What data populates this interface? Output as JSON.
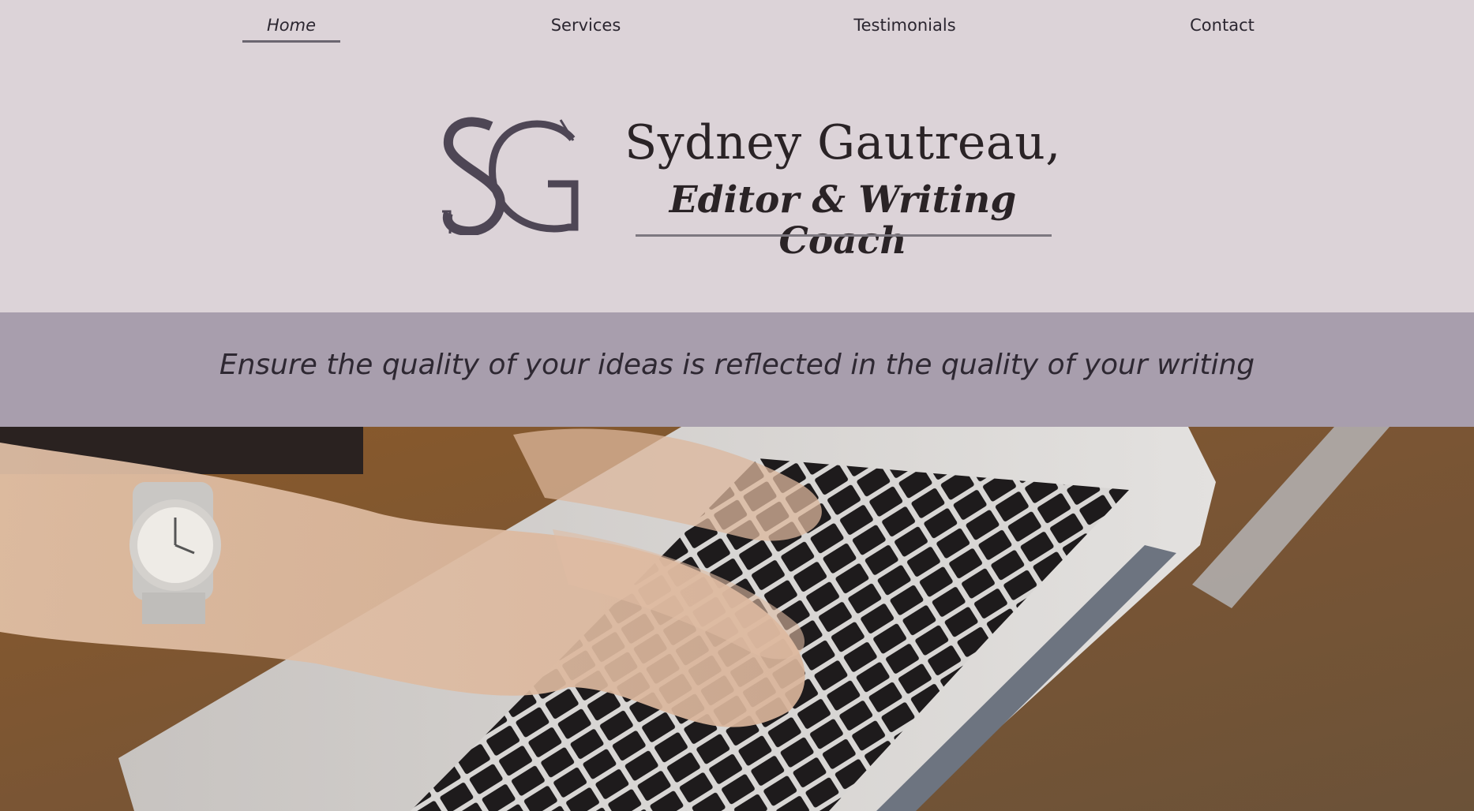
{
  "nav": {
    "items": [
      {
        "label": "Home",
        "active": true
      },
      {
        "label": "Services",
        "active": false
      },
      {
        "label": "Testimonials",
        "active": false
      },
      {
        "label": "Contact",
        "active": false
      }
    ]
  },
  "header": {
    "logo_text": "SG",
    "name": "Sydney Gautreau,",
    "subtitle": "Editor & Writing Coach"
  },
  "tagline": "Ensure the quality of your ideas is reflected in the quality of your writing",
  "colors": {
    "background": "#dcd3d8",
    "band": "#a89ead",
    "logo": "#4e4655",
    "text": "#2a2326"
  },
  "hero_image": "hands-typing-on-laptop-photo"
}
